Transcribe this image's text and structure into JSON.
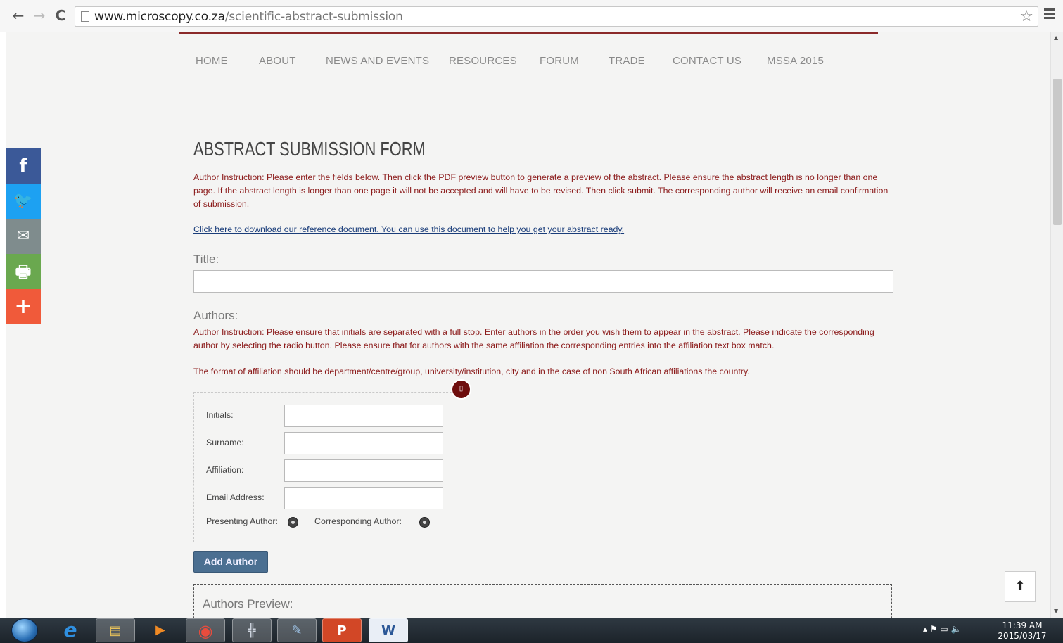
{
  "browser": {
    "url_domain": "www.microscopy.co.za",
    "url_path": "/scientific-abstract-submission",
    "back_label": "←",
    "forward_label": "→",
    "reload_label": "C",
    "star_label": "☆"
  },
  "nav": {
    "items": [
      "HOME",
      "ABOUT",
      "NEWS AND EVENTS",
      "RESOURCES",
      "FORUM",
      "TRADE",
      "CONTACT US",
      "MSSA 2015"
    ]
  },
  "social": {
    "items": [
      {
        "icon": "facebook-icon",
        "glyph": "f",
        "color": "#3b5998"
      },
      {
        "icon": "twitter-icon",
        "glyph": "🐦",
        "color": "#1da1f2"
      },
      {
        "icon": "email-icon",
        "glyph": "✉",
        "color": "#7f8c8d"
      },
      {
        "icon": "print-icon",
        "glyph": "🖶",
        "color": "#6aa84f"
      },
      {
        "icon": "share-plus-icon",
        "glyph": "+",
        "color": "#f05a3a"
      }
    ]
  },
  "form": {
    "title": "ABSTRACT SUBMISSION FORM",
    "instruction": "Author Instruction: Please enter the fields below. Then click the PDF preview button to generate a preview of the abstract. Please ensure the abstract length is no longer than one page. If the abstract length is longer than one page it will not be accepted and will have to be revised. Then click submit. The corresponding author will receive an email confirmation of submission.",
    "download_link": "Click here to download our reference document. You can use this document to help you get your abstract ready.",
    "title_label": "Title:",
    "title_value": "",
    "authors_label": "Authors:",
    "authors_instruction": "Author Instruction: Please ensure that initials are separated with a full stop. Enter authors in the order you wish them to appear in the abstract. Please indicate the corresponding author by selecting the radio button. Please ensure that for authors with the same affiliation the corresponding entries into the affiliation text box match.",
    "affiliation_format": "The format of affiliation should be department/centre/group, university/institution, city and in the case of non South African affiliations the country.",
    "remove_glyph": "▯",
    "fields": {
      "initials": "Initials:",
      "surname": "Surname:",
      "affiliation": "Affiliation:",
      "email": "Email Address:"
    },
    "presenting_author": "Presenting Author:",
    "corresponding_author": "Corresponding Author:",
    "add_author": "Add Author",
    "preview_label": "Authors Preview:",
    "back_to_top_glyph": "⬆"
  },
  "taskbar": {
    "apps": [
      {
        "icon": "internet-explorer-icon",
        "glyph": "e",
        "color": "#2f8fe0"
      },
      {
        "icon": "file-explorer-icon",
        "glyph": "▤",
        "color": "#e8c25a"
      },
      {
        "icon": "media-player-icon",
        "glyph": "▶",
        "color": "#f08a24"
      },
      {
        "icon": "chrome-icon",
        "glyph": "◉",
        "color": "#e84c3d"
      },
      {
        "icon": "network-tool-icon",
        "glyph": "╬",
        "color": "#cfd6e0"
      },
      {
        "icon": "paint-icon",
        "glyph": "✎",
        "color": "#9ec3e6"
      },
      {
        "icon": "powerpoint-icon",
        "glyph": "P",
        "color": "#d24726"
      },
      {
        "icon": "word-icon",
        "glyph": "W",
        "color": "#2b5797"
      }
    ],
    "tray_icons": "▴  ⚑  ▭  🔈",
    "time": "11:39 AM",
    "date": "2015/03/17"
  }
}
